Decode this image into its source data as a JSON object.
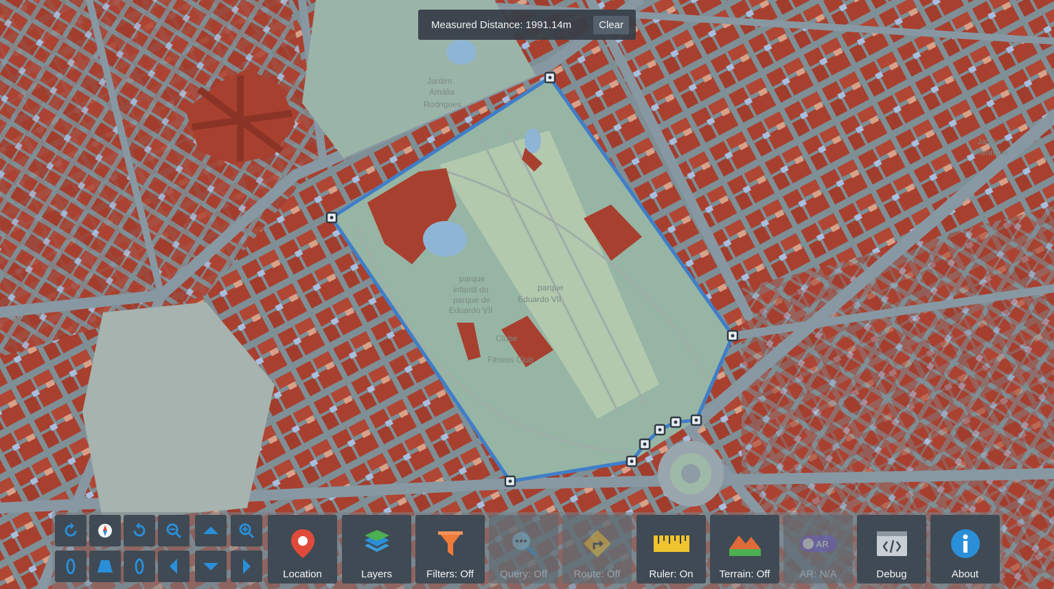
{
  "measurement": {
    "label": "Measured Distance:",
    "value": "1991.14m",
    "clear_label": "Clear"
  },
  "map": {
    "park_labels": [
      "Jardim",
      "Amália",
      "Rodrigues",
      "parque",
      "infantil do",
      "parque de",
      "Eduardo VII",
      "parque",
      "Eduardo VII",
      "Clube",
      "Fitness Club",
      "Jardim",
      "Henrique"
    ]
  },
  "navigation": {
    "rotate_left_icon": "rotate-left-icon",
    "compass_icon": "compass-icon",
    "rotate_right_icon": "rotate-right-icon",
    "zoom_out_icon": "zoom-out-icon",
    "pan_up_icon": "arrow-up-icon",
    "zoom_in_icon": "zoom-in-icon",
    "orbit_left_icon": "orbit-left-icon",
    "tilt_icon": "tilt-icon",
    "orbit_right_icon": "orbit-right-icon",
    "pan_left_icon": "arrow-left-icon",
    "pan_down_icon": "arrow-down-icon",
    "pan_right_icon": "arrow-right-icon"
  },
  "toolbar": {
    "location_label": "Location",
    "layers_label": "Layers",
    "filters_label": "Filters: Off",
    "query_label": "Query: Off",
    "route_label": "Route: Off",
    "ruler_label": "Ruler: On",
    "terrain_label": "Terrain: Off",
    "ar_label": "AR: N/A",
    "ar_badge": "AR",
    "debug_label": "Debug",
    "about_label": "About"
  },
  "colors": {
    "building": "#a8402f",
    "measure_line": "#3f7ec8",
    "toolbar_button": "#3f4a54",
    "accent_blue": "#2a8fd8"
  }
}
